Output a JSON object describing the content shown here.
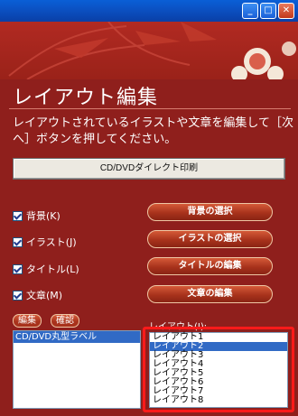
{
  "window": {
    "minimize_glyph": "_",
    "maximize_glyph": "□",
    "close_glyph": "✕"
  },
  "page": {
    "title": "レイアウト編集",
    "description": "レイアウトされているイラストや文章を編集して［次へ］ボタンを押してください。",
    "direct_print_button": "CD/DVDダイレクト印刷"
  },
  "checkboxes": [
    {
      "label": "背景(K)",
      "checked": true
    },
    {
      "label": "イラスト(J)",
      "checked": true
    },
    {
      "label": "タイトル(L)",
      "checked": true
    },
    {
      "label": "文章(M)",
      "checked": true
    }
  ],
  "actions": [
    {
      "label": "背景の選択"
    },
    {
      "label": "イラストの選択"
    },
    {
      "label": "タイトルの編集"
    },
    {
      "label": "文章の編集"
    }
  ],
  "tabs": {
    "edit": "編集",
    "confirm": "確認"
  },
  "media_list": {
    "items": [
      "CD/DVD丸型ラベル"
    ],
    "selected_index": 0
  },
  "layout_list": {
    "label": "レイアウト(I):",
    "items": [
      "レイアウト1",
      "レイアウト2",
      "レイアウト3",
      "レイアウト4",
      "レイアウト5",
      "レイアウト6",
      "レイアウト7",
      "レイアウト8"
    ],
    "selected_index": 1
  },
  "colors": {
    "background": "#8f1f1c",
    "accent_button": "#a8321c",
    "selection": "#316ac5",
    "highlight_frame": "#ff1a1a"
  }
}
